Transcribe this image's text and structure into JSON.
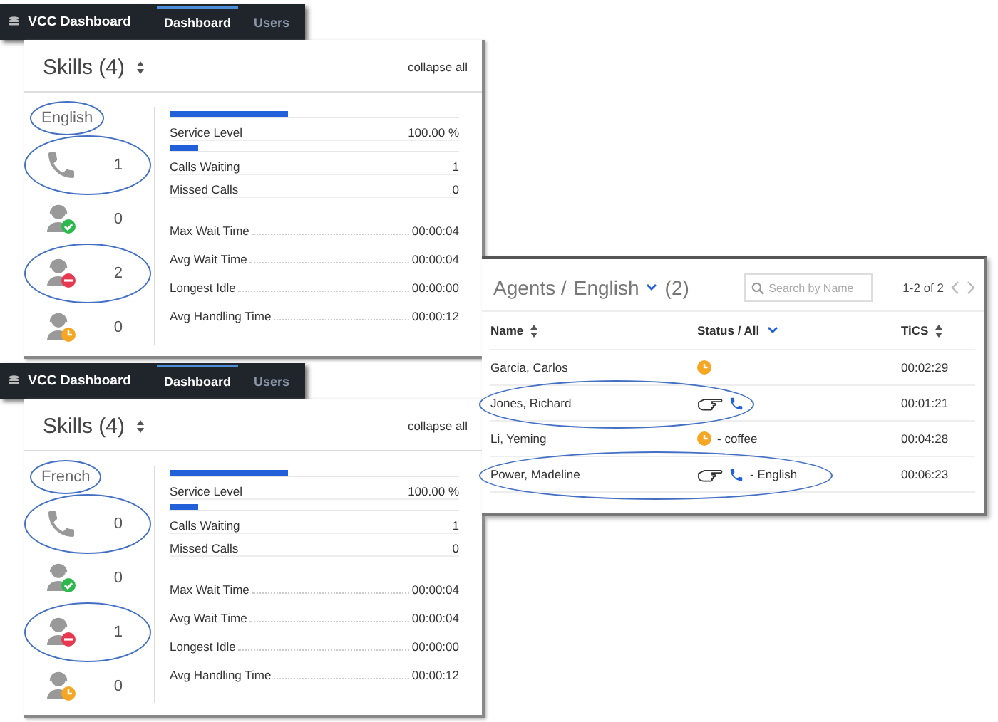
{
  "skill_panels": [
    {
      "app_title": "VCC Dashboard",
      "nav": [
        {
          "label": "Dashboard",
          "selected": true
        },
        {
          "label": "Users",
          "selected": false
        }
      ],
      "heading": "Skills (4)",
      "collapse": "collapse all",
      "skill": "English",
      "skill_highlighted": true,
      "counts": [
        {
          "kind": "calls",
          "value": "1",
          "highlighted": true
        },
        {
          "kind": "ready",
          "value": "0",
          "highlighted": false
        },
        {
          "kind": "not_ready",
          "value": "2",
          "highlighted": true
        },
        {
          "kind": "away",
          "value": "0",
          "highlighted": false
        }
      ],
      "metrics": [
        {
          "kind": "bar",
          "label": "Service Level",
          "value": "100.00 %",
          "level": 0.41
        },
        {
          "kind": "bar",
          "label": "Calls Waiting",
          "value": "1",
          "level": 0.1
        },
        {
          "kind": "plain",
          "label": "Missed Calls",
          "value": "0"
        },
        {
          "kind": "dotted",
          "label": "Max Wait Time",
          "value": "00:00:04"
        },
        {
          "kind": "dotted",
          "label": "Avg Wait Time",
          "value": "00:00:04"
        },
        {
          "kind": "dotted",
          "label": "Longest Idle",
          "value": "00:00:00"
        },
        {
          "kind": "dotted",
          "label": "Avg Handling Time",
          "value": "00:00:12"
        }
      ]
    },
    {
      "app_title": "VCC Dashboard",
      "nav": [
        {
          "label": "Dashboard",
          "selected": true
        },
        {
          "label": "Users",
          "selected": false
        }
      ],
      "heading": "Skills (4)",
      "collapse": "collapse all",
      "skill": "French",
      "skill_highlighted": true,
      "counts": [
        {
          "kind": "calls",
          "value": "0",
          "highlighted": true
        },
        {
          "kind": "ready",
          "value": "0",
          "highlighted": false
        },
        {
          "kind": "not_ready",
          "value": "1",
          "highlighted": true
        },
        {
          "kind": "away",
          "value": "0",
          "highlighted": false
        }
      ],
      "metrics": [
        {
          "kind": "bar",
          "label": "Service Level",
          "value": "100.00 %",
          "level": 0.41
        },
        {
          "kind": "bar",
          "label": "Calls Waiting",
          "value": "1",
          "level": 0.1
        },
        {
          "kind": "plain",
          "label": "Missed Calls",
          "value": "0"
        },
        {
          "kind": "dotted",
          "label": "Max Wait Time",
          "value": "00:00:04"
        },
        {
          "kind": "dotted",
          "label": "Avg Wait Time",
          "value": "00:00:04"
        },
        {
          "kind": "dotted",
          "label": "Longest Idle",
          "value": "00:00:00"
        },
        {
          "kind": "dotted",
          "label": "Avg Handling Time",
          "value": "00:00:12"
        }
      ]
    }
  ],
  "agents": {
    "title": "Agents /",
    "skill": "English",
    "count": "(2)",
    "search": {
      "placeholder": "Search by Name"
    },
    "pager": "1-2 of 2",
    "columns": [
      "Name",
      "Status / All",
      "TiCS"
    ],
    "rows": [
      {
        "name": "Garcia, Carlos",
        "kind": "away",
        "time": "00:02:29",
        "highlighted": false
      },
      {
        "name": "Jones, Richard",
        "kind": "calls",
        "time": "00:01:21",
        "highlighted": true
      },
      {
        "name": "Li, Yeming",
        "kind": "away",
        "note": "- coffee",
        "time": "00:04:28",
        "highlighted": false
      },
      {
        "name": "Power, Madeline",
        "kind": "calls",
        "note": "- English",
        "time": "00:06:23",
        "highlighted": true
      }
    ]
  }
}
